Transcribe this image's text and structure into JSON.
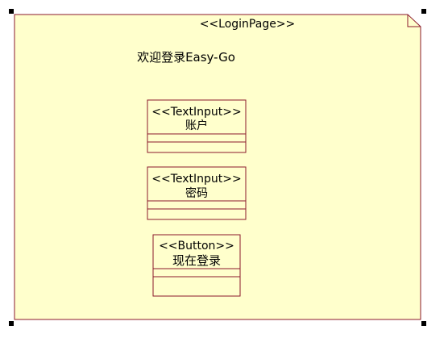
{
  "page": {
    "stereotype": "<<LoginPage>>",
    "welcome_text": "欢迎登录Easy-Go"
  },
  "components": [
    {
      "stereotype": "<<TextInput>>",
      "name": "账户"
    },
    {
      "stereotype": "<<TextInput>>",
      "name": "密码"
    },
    {
      "stereotype": "<<Button>>",
      "name": "现在登录"
    }
  ],
  "colors": {
    "fill": "#ffffcc",
    "border": "#8b1a2b",
    "handle": "#000000"
  }
}
